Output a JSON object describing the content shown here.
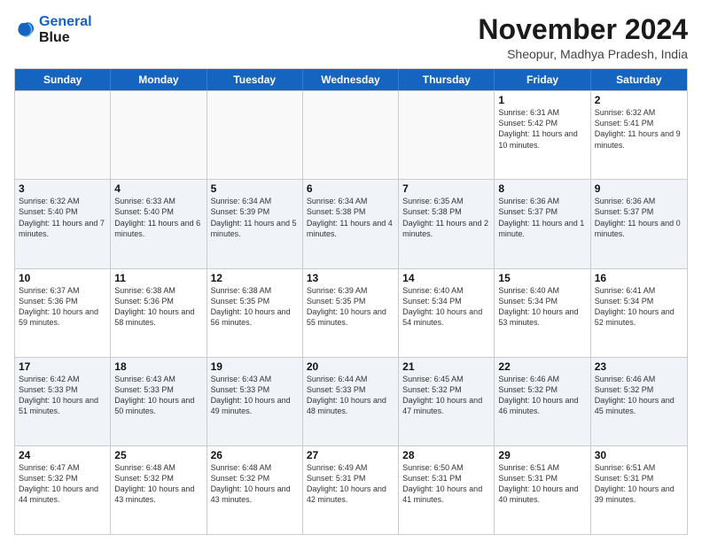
{
  "header": {
    "logo_line1": "General",
    "logo_line2": "Blue",
    "month_title": "November 2024",
    "location": "Sheopur, Madhya Pradesh, India"
  },
  "weekdays": [
    "Sunday",
    "Monday",
    "Tuesday",
    "Wednesday",
    "Thursday",
    "Friday",
    "Saturday"
  ],
  "rows": [
    {
      "alt": false,
      "cells": [
        {
          "day": "",
          "text": ""
        },
        {
          "day": "",
          "text": ""
        },
        {
          "day": "",
          "text": ""
        },
        {
          "day": "",
          "text": ""
        },
        {
          "day": "",
          "text": ""
        },
        {
          "day": "1",
          "text": "Sunrise: 6:31 AM\nSunset: 5:42 PM\nDaylight: 11 hours and 10 minutes."
        },
        {
          "day": "2",
          "text": "Sunrise: 6:32 AM\nSunset: 5:41 PM\nDaylight: 11 hours and 9 minutes."
        }
      ]
    },
    {
      "alt": true,
      "cells": [
        {
          "day": "3",
          "text": "Sunrise: 6:32 AM\nSunset: 5:40 PM\nDaylight: 11 hours and 7 minutes."
        },
        {
          "day": "4",
          "text": "Sunrise: 6:33 AM\nSunset: 5:40 PM\nDaylight: 11 hours and 6 minutes."
        },
        {
          "day": "5",
          "text": "Sunrise: 6:34 AM\nSunset: 5:39 PM\nDaylight: 11 hours and 5 minutes."
        },
        {
          "day": "6",
          "text": "Sunrise: 6:34 AM\nSunset: 5:38 PM\nDaylight: 11 hours and 4 minutes."
        },
        {
          "day": "7",
          "text": "Sunrise: 6:35 AM\nSunset: 5:38 PM\nDaylight: 11 hours and 2 minutes."
        },
        {
          "day": "8",
          "text": "Sunrise: 6:36 AM\nSunset: 5:37 PM\nDaylight: 11 hours and 1 minute."
        },
        {
          "day": "9",
          "text": "Sunrise: 6:36 AM\nSunset: 5:37 PM\nDaylight: 11 hours and 0 minutes."
        }
      ]
    },
    {
      "alt": false,
      "cells": [
        {
          "day": "10",
          "text": "Sunrise: 6:37 AM\nSunset: 5:36 PM\nDaylight: 10 hours and 59 minutes."
        },
        {
          "day": "11",
          "text": "Sunrise: 6:38 AM\nSunset: 5:36 PM\nDaylight: 10 hours and 58 minutes."
        },
        {
          "day": "12",
          "text": "Sunrise: 6:38 AM\nSunset: 5:35 PM\nDaylight: 10 hours and 56 minutes."
        },
        {
          "day": "13",
          "text": "Sunrise: 6:39 AM\nSunset: 5:35 PM\nDaylight: 10 hours and 55 minutes."
        },
        {
          "day": "14",
          "text": "Sunrise: 6:40 AM\nSunset: 5:34 PM\nDaylight: 10 hours and 54 minutes."
        },
        {
          "day": "15",
          "text": "Sunrise: 6:40 AM\nSunset: 5:34 PM\nDaylight: 10 hours and 53 minutes."
        },
        {
          "day": "16",
          "text": "Sunrise: 6:41 AM\nSunset: 5:34 PM\nDaylight: 10 hours and 52 minutes."
        }
      ]
    },
    {
      "alt": true,
      "cells": [
        {
          "day": "17",
          "text": "Sunrise: 6:42 AM\nSunset: 5:33 PM\nDaylight: 10 hours and 51 minutes."
        },
        {
          "day": "18",
          "text": "Sunrise: 6:43 AM\nSunset: 5:33 PM\nDaylight: 10 hours and 50 minutes."
        },
        {
          "day": "19",
          "text": "Sunrise: 6:43 AM\nSunset: 5:33 PM\nDaylight: 10 hours and 49 minutes."
        },
        {
          "day": "20",
          "text": "Sunrise: 6:44 AM\nSunset: 5:33 PM\nDaylight: 10 hours and 48 minutes."
        },
        {
          "day": "21",
          "text": "Sunrise: 6:45 AM\nSunset: 5:32 PM\nDaylight: 10 hours and 47 minutes."
        },
        {
          "day": "22",
          "text": "Sunrise: 6:46 AM\nSunset: 5:32 PM\nDaylight: 10 hours and 46 minutes."
        },
        {
          "day": "23",
          "text": "Sunrise: 6:46 AM\nSunset: 5:32 PM\nDaylight: 10 hours and 45 minutes."
        }
      ]
    },
    {
      "alt": false,
      "cells": [
        {
          "day": "24",
          "text": "Sunrise: 6:47 AM\nSunset: 5:32 PM\nDaylight: 10 hours and 44 minutes."
        },
        {
          "day": "25",
          "text": "Sunrise: 6:48 AM\nSunset: 5:32 PM\nDaylight: 10 hours and 43 minutes."
        },
        {
          "day": "26",
          "text": "Sunrise: 6:48 AM\nSunset: 5:32 PM\nDaylight: 10 hours and 43 minutes."
        },
        {
          "day": "27",
          "text": "Sunrise: 6:49 AM\nSunset: 5:31 PM\nDaylight: 10 hours and 42 minutes."
        },
        {
          "day": "28",
          "text": "Sunrise: 6:50 AM\nSunset: 5:31 PM\nDaylight: 10 hours and 41 minutes."
        },
        {
          "day": "29",
          "text": "Sunrise: 6:51 AM\nSunset: 5:31 PM\nDaylight: 10 hours and 40 minutes."
        },
        {
          "day": "30",
          "text": "Sunrise: 6:51 AM\nSunset: 5:31 PM\nDaylight: 10 hours and 39 minutes."
        }
      ]
    }
  ]
}
